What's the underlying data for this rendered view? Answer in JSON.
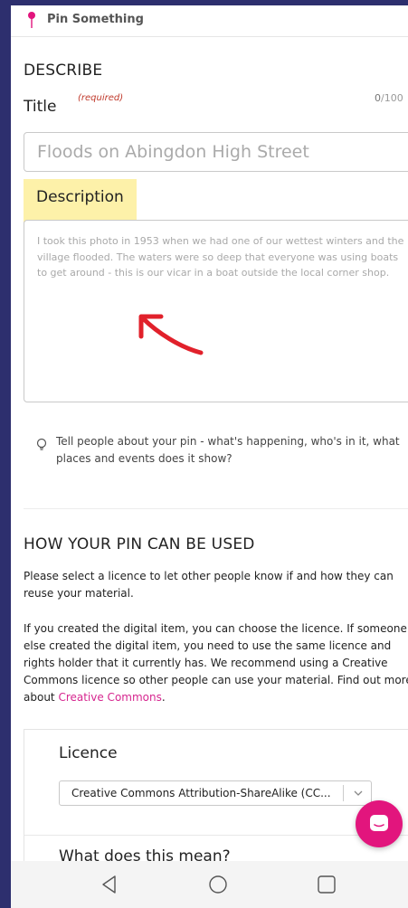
{
  "header": {
    "title": "Pin Something",
    "icon": "map-pin-icon",
    "accent": "#e2157d"
  },
  "describe": {
    "section_title": "DESCRIBE",
    "title_label": "Title",
    "title_required": "(required)",
    "title_counter_current": "0",
    "title_counter_max": "/100",
    "title_placeholder": "Floods on Abingdon High Street",
    "description_label": "Description",
    "description_placeholder": "I took this photo in 1953 when we had one of our wettest winters and the village flooded. The waters were so deep that everyone was using boats to get around - this is our vicar in a boat outside the local corner shop.",
    "hint_icon": "lightbulb-icon",
    "hint": "Tell people about your pin - what's happening, who's in it, what places and events does it show?"
  },
  "usage": {
    "section_title": "HOW YOUR PIN CAN BE USED",
    "para1": "Please select a licence to let other people know if and how they can reuse your material.",
    "para2": "If you created the digital item, you can choose the licence. If someone else created the digital item, you need to use the same licence and rights holder that it currently has. We recommend using a Creative Commons licence so other people can use your material. Find out more about ",
    "link_text": "Creative Commons",
    "para2_end": ".",
    "licence_label": "Licence",
    "licence_selected": "Creative Commons Attribution-ShareAlike (CC...",
    "what_means": "What does this mean?"
  },
  "chat_button": {
    "icon": "chat-bubble-icon"
  },
  "navbar": {
    "back": "back-triangle-icon",
    "home": "home-circle-icon",
    "recent": "recent-square-icon"
  }
}
